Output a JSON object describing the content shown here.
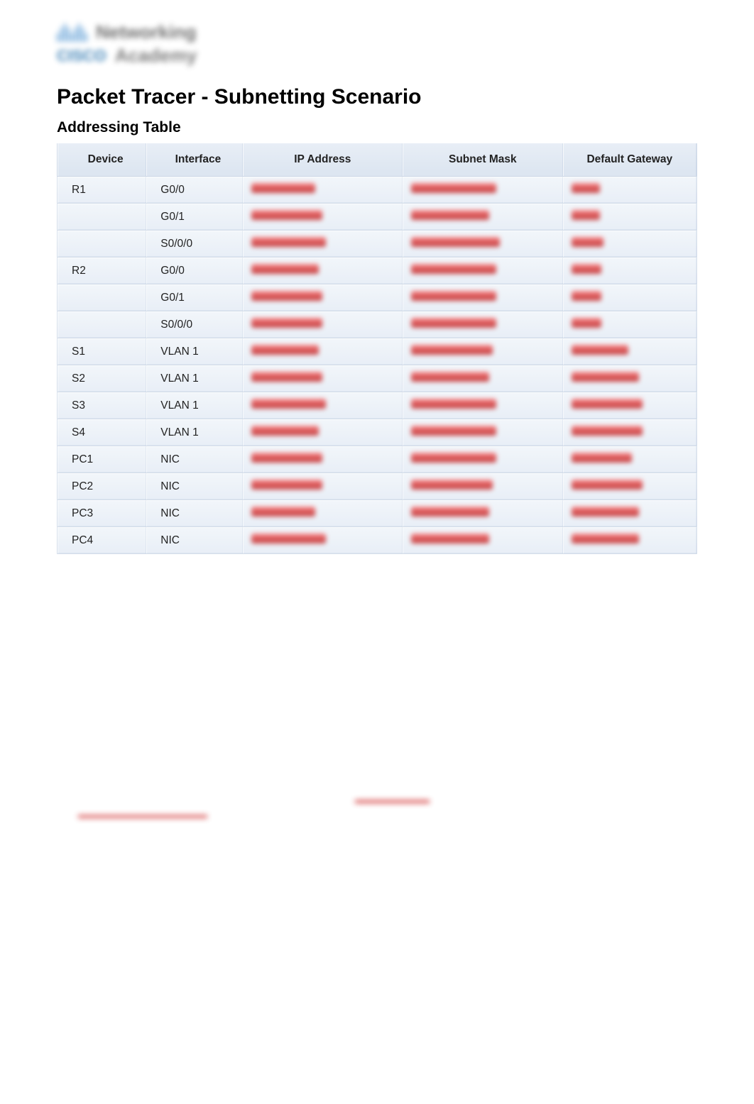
{
  "logo": {
    "brand": "CISCO",
    "line1": "Networking",
    "line2": "Academy"
  },
  "title": "Packet Tracer - Subnetting Scenario",
  "addressing_table": {
    "heading": "Addressing  Table",
    "columns": [
      "Device",
      "Interface",
      "IP Address",
      "Subnet Mask",
      "Default Gateway"
    ],
    "rows": [
      {
        "device": "R1",
        "interface": "G0/0",
        "ip_w": 90,
        "mask_w": 120,
        "gw_w": 40
      },
      {
        "device": "",
        "interface": "G0/1",
        "ip_w": 100,
        "mask_w": 110,
        "gw_w": 40
      },
      {
        "device": "",
        "interface": "S0/0/0",
        "ip_w": 105,
        "mask_w": 125,
        "gw_w": 45
      },
      {
        "device": "R2",
        "interface": "G0/0",
        "ip_w": 95,
        "mask_w": 120,
        "gw_w": 42
      },
      {
        "device": "",
        "interface": "G0/1",
        "ip_w": 100,
        "mask_w": 120,
        "gw_w": 42
      },
      {
        "device": "",
        "interface": "S0/0/0",
        "ip_w": 100,
        "mask_w": 120,
        "gw_w": 42
      },
      {
        "device": "S1",
        "interface": "VLAN 1",
        "ip_w": 95,
        "mask_w": 115,
        "gw_w": 80
      },
      {
        "device": "S2",
        "interface": "VLAN 1",
        "ip_w": 100,
        "mask_w": 110,
        "gw_w": 95
      },
      {
        "device": "S3",
        "interface": "VLAN 1",
        "ip_w": 105,
        "mask_w": 120,
        "gw_w": 100
      },
      {
        "device": "S4",
        "interface": "VLAN 1",
        "ip_w": 95,
        "mask_w": 120,
        "gw_w": 100
      },
      {
        "device": "PC1",
        "interface": "NIC",
        "ip_w": 100,
        "mask_w": 120,
        "gw_w": 85
      },
      {
        "device": "PC2",
        "interface": "NIC",
        "ip_w": 100,
        "mask_w": 115,
        "gw_w": 100
      },
      {
        "device": "PC3",
        "interface": "NIC",
        "ip_w": 90,
        "mask_w": 110,
        "gw_w": 95
      },
      {
        "device": "PC4",
        "interface": "NIC",
        "ip_w": 105,
        "mask_w": 110,
        "gw_w": 95
      }
    ]
  }
}
